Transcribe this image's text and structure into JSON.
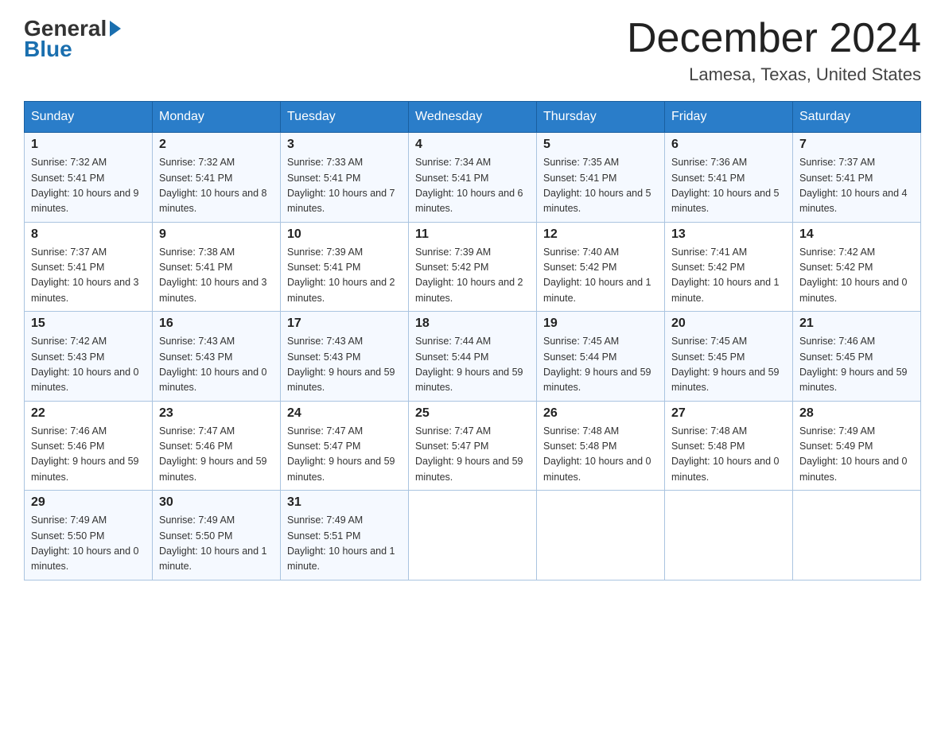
{
  "logo": {
    "general": "General",
    "blue": "Blue"
  },
  "title": "December 2024",
  "location": "Lamesa, Texas, United States",
  "days_of_week": [
    "Sunday",
    "Monday",
    "Tuesday",
    "Wednesday",
    "Thursday",
    "Friday",
    "Saturday"
  ],
  "weeks": [
    [
      {
        "day": "1",
        "sunrise": "7:32 AM",
        "sunset": "5:41 PM",
        "daylight": "10 hours and 9 minutes."
      },
      {
        "day": "2",
        "sunrise": "7:32 AM",
        "sunset": "5:41 PM",
        "daylight": "10 hours and 8 minutes."
      },
      {
        "day": "3",
        "sunrise": "7:33 AM",
        "sunset": "5:41 PM",
        "daylight": "10 hours and 7 minutes."
      },
      {
        "day": "4",
        "sunrise": "7:34 AM",
        "sunset": "5:41 PM",
        "daylight": "10 hours and 6 minutes."
      },
      {
        "day": "5",
        "sunrise": "7:35 AM",
        "sunset": "5:41 PM",
        "daylight": "10 hours and 5 minutes."
      },
      {
        "day": "6",
        "sunrise": "7:36 AM",
        "sunset": "5:41 PM",
        "daylight": "10 hours and 5 minutes."
      },
      {
        "day": "7",
        "sunrise": "7:37 AM",
        "sunset": "5:41 PM",
        "daylight": "10 hours and 4 minutes."
      }
    ],
    [
      {
        "day": "8",
        "sunrise": "7:37 AM",
        "sunset": "5:41 PM",
        "daylight": "10 hours and 3 minutes."
      },
      {
        "day": "9",
        "sunrise": "7:38 AM",
        "sunset": "5:41 PM",
        "daylight": "10 hours and 3 minutes."
      },
      {
        "day": "10",
        "sunrise": "7:39 AM",
        "sunset": "5:41 PM",
        "daylight": "10 hours and 2 minutes."
      },
      {
        "day": "11",
        "sunrise": "7:39 AM",
        "sunset": "5:42 PM",
        "daylight": "10 hours and 2 minutes."
      },
      {
        "day": "12",
        "sunrise": "7:40 AM",
        "sunset": "5:42 PM",
        "daylight": "10 hours and 1 minute."
      },
      {
        "day": "13",
        "sunrise": "7:41 AM",
        "sunset": "5:42 PM",
        "daylight": "10 hours and 1 minute."
      },
      {
        "day": "14",
        "sunrise": "7:42 AM",
        "sunset": "5:42 PM",
        "daylight": "10 hours and 0 minutes."
      }
    ],
    [
      {
        "day": "15",
        "sunrise": "7:42 AM",
        "sunset": "5:43 PM",
        "daylight": "10 hours and 0 minutes."
      },
      {
        "day": "16",
        "sunrise": "7:43 AM",
        "sunset": "5:43 PM",
        "daylight": "10 hours and 0 minutes."
      },
      {
        "day": "17",
        "sunrise": "7:43 AM",
        "sunset": "5:43 PM",
        "daylight": "9 hours and 59 minutes."
      },
      {
        "day": "18",
        "sunrise": "7:44 AM",
        "sunset": "5:44 PM",
        "daylight": "9 hours and 59 minutes."
      },
      {
        "day": "19",
        "sunrise": "7:45 AM",
        "sunset": "5:44 PM",
        "daylight": "9 hours and 59 minutes."
      },
      {
        "day": "20",
        "sunrise": "7:45 AM",
        "sunset": "5:45 PM",
        "daylight": "9 hours and 59 minutes."
      },
      {
        "day": "21",
        "sunrise": "7:46 AM",
        "sunset": "5:45 PM",
        "daylight": "9 hours and 59 minutes."
      }
    ],
    [
      {
        "day": "22",
        "sunrise": "7:46 AM",
        "sunset": "5:46 PM",
        "daylight": "9 hours and 59 minutes."
      },
      {
        "day": "23",
        "sunrise": "7:47 AM",
        "sunset": "5:46 PM",
        "daylight": "9 hours and 59 minutes."
      },
      {
        "day": "24",
        "sunrise": "7:47 AM",
        "sunset": "5:47 PM",
        "daylight": "9 hours and 59 minutes."
      },
      {
        "day": "25",
        "sunrise": "7:47 AM",
        "sunset": "5:47 PM",
        "daylight": "9 hours and 59 minutes."
      },
      {
        "day": "26",
        "sunrise": "7:48 AM",
        "sunset": "5:48 PM",
        "daylight": "10 hours and 0 minutes."
      },
      {
        "day": "27",
        "sunrise": "7:48 AM",
        "sunset": "5:48 PM",
        "daylight": "10 hours and 0 minutes."
      },
      {
        "day": "28",
        "sunrise": "7:49 AM",
        "sunset": "5:49 PM",
        "daylight": "10 hours and 0 minutes."
      }
    ],
    [
      {
        "day": "29",
        "sunrise": "7:49 AM",
        "sunset": "5:50 PM",
        "daylight": "10 hours and 0 minutes."
      },
      {
        "day": "30",
        "sunrise": "7:49 AM",
        "sunset": "5:50 PM",
        "daylight": "10 hours and 1 minute."
      },
      {
        "day": "31",
        "sunrise": "7:49 AM",
        "sunset": "5:51 PM",
        "daylight": "10 hours and 1 minute."
      },
      null,
      null,
      null,
      null
    ]
  ]
}
